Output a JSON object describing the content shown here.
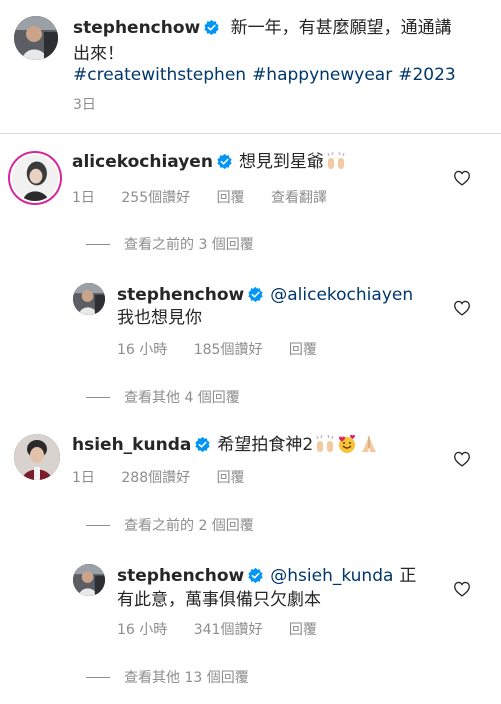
{
  "post": {
    "author": "stephenchow",
    "caption_line1": "新一年，有甚麼願望，通通講",
    "caption_line2": "出來！",
    "hashtags": [
      "#createwithstephen",
      "#happynewyear",
      "#2023"
    ],
    "age": "3日"
  },
  "comments": [
    {
      "username": "alicekochiayen",
      "text": "想見到星爺",
      "emoji": "raising-hands",
      "age": "1日",
      "likes": "255個讚好",
      "reply_label": "回覆",
      "translate_label": "查看翻譯",
      "view_previous": "查看之前的 3 個回覆",
      "reply": {
        "username": "stephenchow",
        "mention": "@alicekochiayen",
        "text": "我也想見你",
        "age": "16 小時",
        "likes": "185個讚好",
        "reply_label": "回覆"
      },
      "view_more": "查看其他 4 個回覆"
    },
    {
      "username": "hsieh_kunda",
      "text": "希望拍食神2",
      "emojis": [
        "raising-hands",
        "smiling-face-with-hearts",
        "folded-hands"
      ],
      "age": "1日",
      "likes": "288個讚好",
      "reply_label": "回覆",
      "view_previous": "查看之前的 2 個回覆",
      "reply": {
        "username": "stephenchow",
        "mention": "@hsieh_kunda",
        "text_line1": "正",
        "text_line2": "有此意，萬事俱備只欠劇本",
        "age": "16 小時",
        "likes": "341個讚好",
        "reply_label": "回覆"
      },
      "view_more": "查看其他 13 個回覆"
    }
  ],
  "colors": {
    "text": "#262626",
    "secondary": "#8e8e8e",
    "link": "#00376b",
    "verified": "#0095f6",
    "divider": "#dbdbdb"
  }
}
